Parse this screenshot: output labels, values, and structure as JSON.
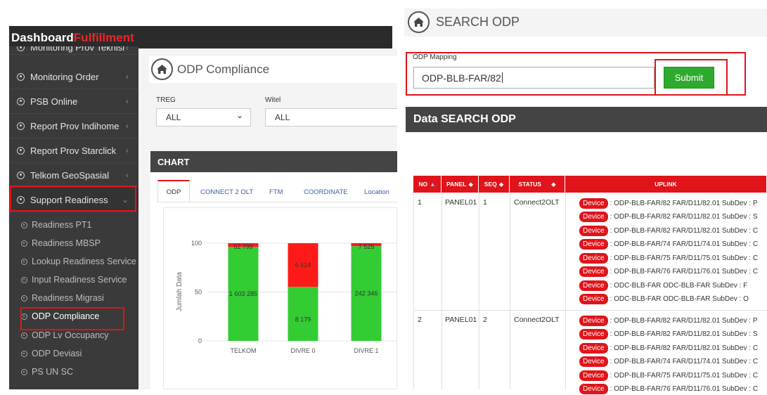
{
  "left": {
    "brand": {
      "part1": "Dashboard",
      "part2": "Fulfillment",
      "part1_color": "#ffffff",
      "part2_color": "#e8262b"
    },
    "sidebar": {
      "items": [
        {
          "label": "Monitoring Prov Teknisi"
        },
        {
          "label": "Monitoring Order"
        },
        {
          "label": "PSB Online"
        },
        {
          "label": "Report Prov Indihome"
        },
        {
          "label": "Report Prov Starclick"
        },
        {
          "label": "Telkom GeoSpasial"
        },
        {
          "label": "Support Readiness"
        }
      ],
      "chevron": "‹",
      "chevron_open": "⌄",
      "subitems": [
        {
          "label": "Readiness PT1"
        },
        {
          "label": "Readiness MBSP"
        },
        {
          "label": "Lookup Readiness Service"
        },
        {
          "label": "Input Readiness Service"
        },
        {
          "label": "Readiness Migrasi"
        },
        {
          "label": "ODP Compliance"
        },
        {
          "label": "ODP Lv Occupancy"
        },
        {
          "label": "ODP Deviasi"
        },
        {
          "label": "PS UN SC"
        }
      ]
    },
    "page_title": "ODP Compliance",
    "filters": {
      "treg_label": "TREG",
      "treg_value": "ALL",
      "treg_chevron": "⌄",
      "witel_label": "Witel",
      "witel_value": "ALL"
    },
    "chart_header": "CHART",
    "tabs": [
      "ODP",
      "CONNECT 2 OLT",
      "FTM",
      "COORDINATE",
      "Location"
    ],
    "chart_data": {
      "type": "bar",
      "stacked": true,
      "percent_scale": true,
      "categories": [
        "TELKOM",
        "DIVRE 0",
        "DIVRE 1"
      ],
      "series": [
        {
          "color": "#33cc33",
          "values": [
            1603285,
            8179,
            242346
          ],
          "percent": [
            96.2,
            55.3,
            97.0
          ]
        },
        {
          "color": "#ff1a1a",
          "values": [
            62799,
            6614,
            7525
          ],
          "percent": [
            3.8,
            44.7,
            3.0
          ]
        }
      ],
      "value_labels": {
        "green": [
          "1 603 285",
          "8 179",
          "242 346"
        ],
        "red": [
          "62 799",
          "6 614",
          "7 525"
        ]
      },
      "ylabel": "Jumlah Data",
      "yticks": [
        "0",
        "50",
        "100"
      ],
      "ylim": [
        0,
        100
      ]
    }
  },
  "right": {
    "search_title": "SEARCH ODP",
    "mapping_label": "ODP Mapping",
    "mapping_value": "ODP-BLB-FAR/82",
    "submit_label": "Submit",
    "data_header": "Data SEARCH ODP",
    "table": {
      "headers": [
        "NO",
        "PANEL",
        "SEQ",
        "STATUS",
        "UPLINK"
      ],
      "sort_icons": [
        "▲",
        "◆",
        "◆",
        "◆"
      ],
      "rows": [
        {
          "no": "1",
          "panel": "PANEL01",
          "seq": "1",
          "status": "Connect2OLT",
          "uplink": [
            ": ODP-BLB-FAR/82 FAR/D11/82.01 SubDev : P",
            ": ODP-BLB-FAR/82 FAR/D11/82.01 SubDev : S",
            ": ODP-BLB-FAR/82 FAR/D11/82.01 SubDev : C",
            ": ODP-BLB-FAR/74 FAR/D11/74.01 SubDev : C",
            ": ODP-BLB-FAR/75 FAR/D11/75.01 SubDev : C",
            ": ODP-BLB-FAR/76 FAR/D11/76.01 SubDev : C",
            ": ODC-BLB-FAR ODC-BLB-FAR         SubDev : F",
            ": ODC-BLB-FAR ODC-BLB-FAR         SubDev : O"
          ]
        },
        {
          "no": "2",
          "panel": "PANEL01",
          "seq": "2",
          "status": "Connect2OLT",
          "uplink": [
            ": ODP-BLB-FAR/82 FAR/D11/82.01 SubDev : P",
            ": ODP-BLB-FAR/82 FAR/D11/82.01 SubDev : S",
            ": ODP-BLB-FAR/82 FAR/D11/82.01 SubDev : C",
            ": ODP-BLB-FAR/74 FAR/D11/74.01 SubDev : C",
            ": ODP-BLB-FAR/75 FAR/D11/75.01 SubDev : C",
            ": ODP-BLB-FAR/76 FAR/D11/76.01 SubDev : C"
          ]
        }
      ],
      "badge_label": "Device"
    }
  },
  "colors": {
    "accent_red": "#e0141a",
    "submit_green": "#2eaa2e",
    "dark_header": "#444444",
    "sidebar_bg": "#3a3a3a"
  },
  "icons": {
    "home": "home-icon",
    "bullet": "circle-dot-icon",
    "sort": "sort-icon"
  }
}
